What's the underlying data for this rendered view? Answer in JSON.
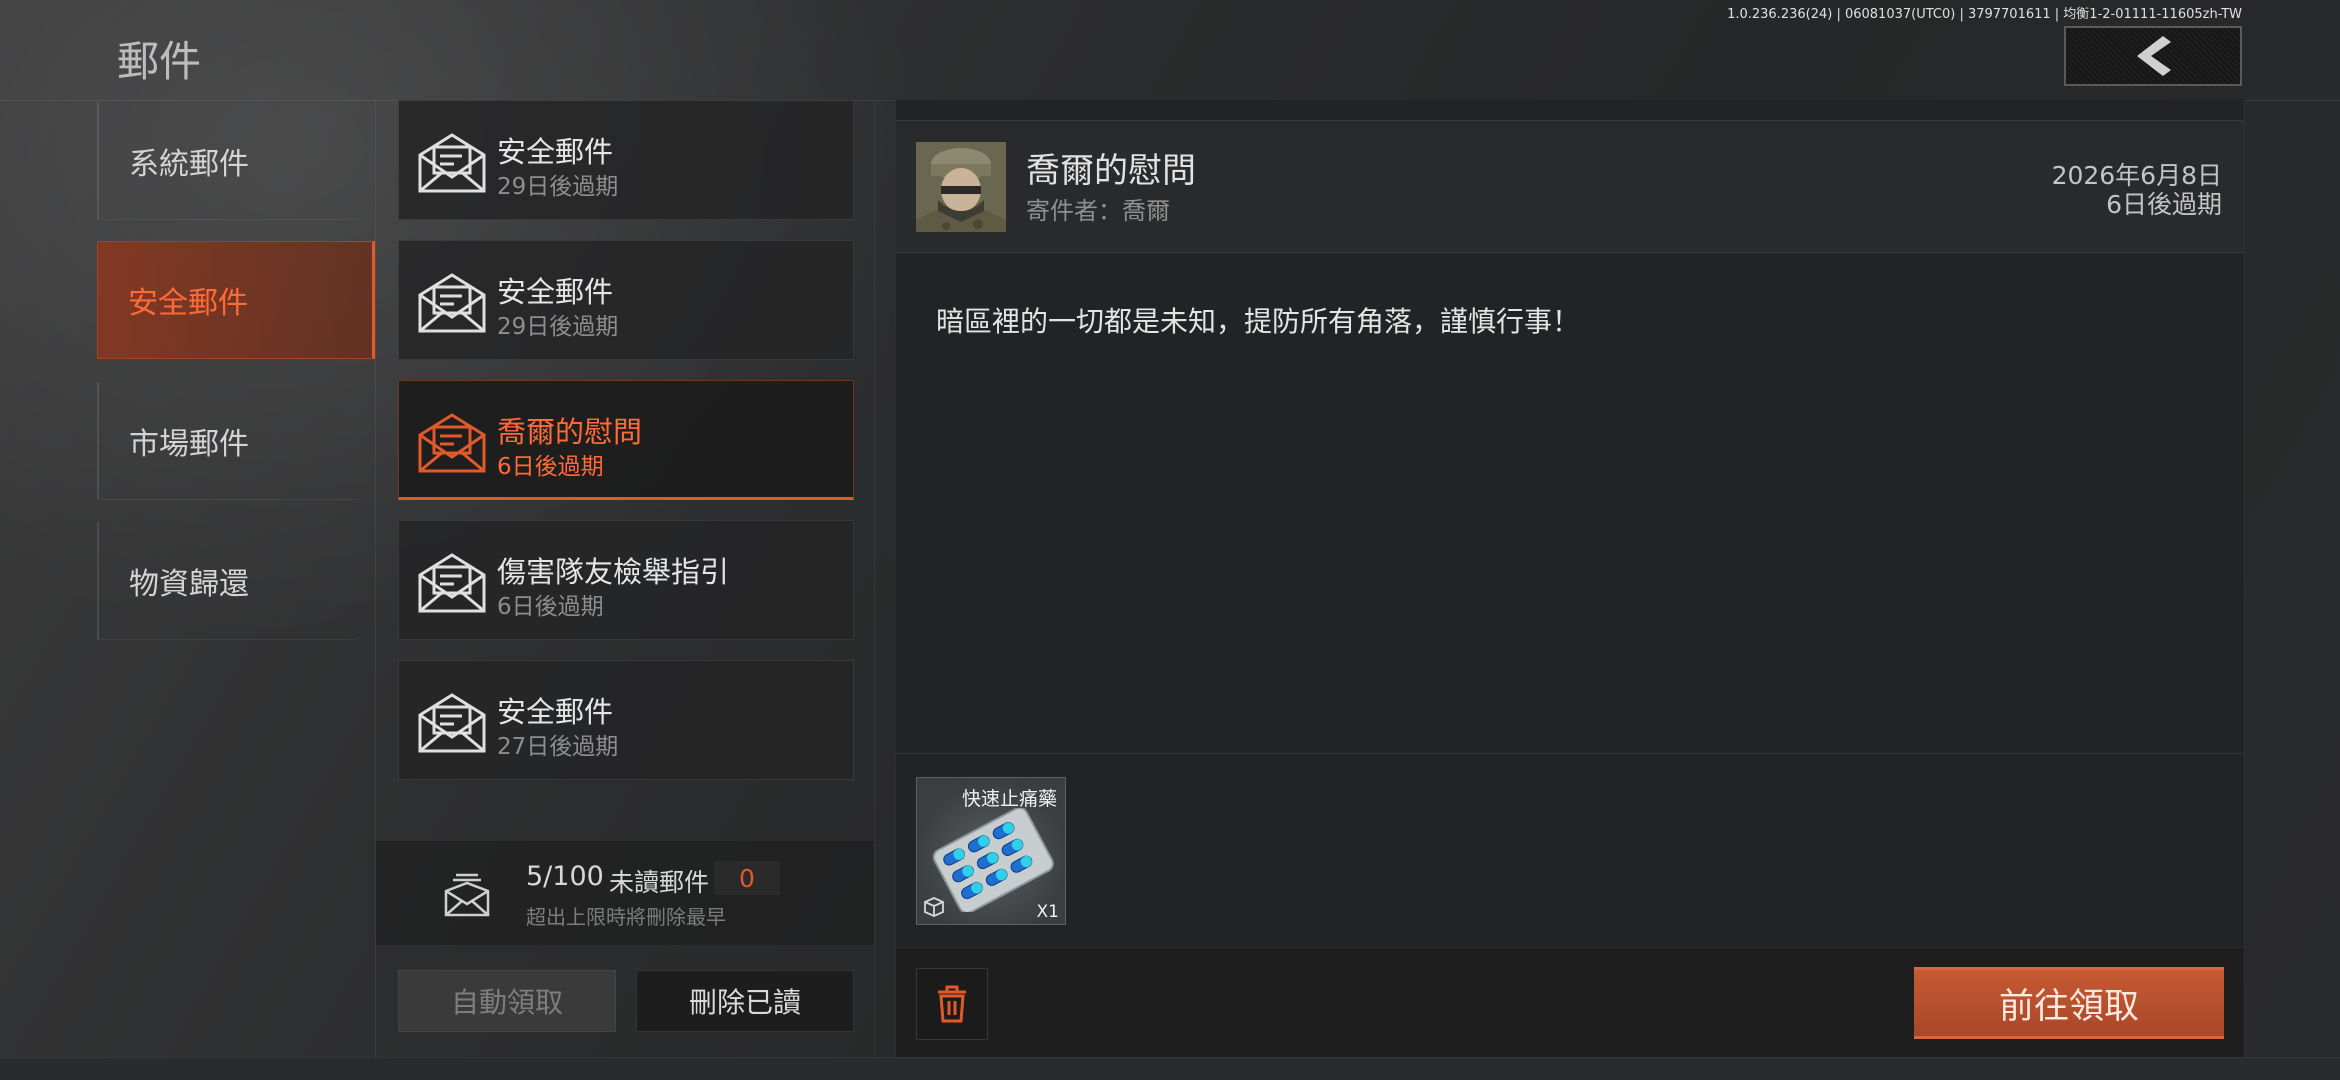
{
  "header": {
    "version": "1.0.236.236(24) | 06081037(UTC0) | 3797701611 | 均衡1-2-01111-11605zh-TW",
    "title": "郵件",
    "back_icon": "chevron-left-icon"
  },
  "sidebar": {
    "items": [
      {
        "label": "系統郵件",
        "active": false
      },
      {
        "label": "安全郵件",
        "active": true
      },
      {
        "label": "市場郵件",
        "active": false
      },
      {
        "label": "物資歸還",
        "active": false
      }
    ]
  },
  "mail_list": {
    "items": [
      {
        "title": "安全郵件",
        "expiry": "29日後過期",
        "selected": false
      },
      {
        "title": "安全郵件",
        "expiry": "29日後過期",
        "selected": false
      },
      {
        "title": "喬爾的慰問",
        "expiry": "6日後過期",
        "selected": true
      },
      {
        "title": "傷害隊友檢舉指引",
        "expiry": "6日後過期",
        "selected": false
      },
      {
        "title": "安全郵件",
        "expiry": "27日後過期",
        "selected": false
      }
    ],
    "summary": {
      "count": "5/100",
      "unread_label": "未讀郵件",
      "unread_count": "0",
      "note": "超出上限時將刪除最早"
    },
    "buttons": {
      "auto_claim": "自動領取",
      "delete_read": "刪除已讀"
    }
  },
  "detail": {
    "title": "喬爾的慰問",
    "sender": "寄件者：喬爾",
    "date": "2026年6月8日",
    "expiry": "6日後過期",
    "body": "暗區裡的一切都是未知，提防所有角落，謹慎行事！",
    "attachment": {
      "name": "快速止痛藥",
      "quantity": "X1"
    },
    "claim_button": "前往領取",
    "trash_icon": "trash-icon"
  },
  "colors": {
    "accent": "#e05a2a",
    "claim_button": "#b84f2d",
    "background": "#2b2c2d"
  }
}
